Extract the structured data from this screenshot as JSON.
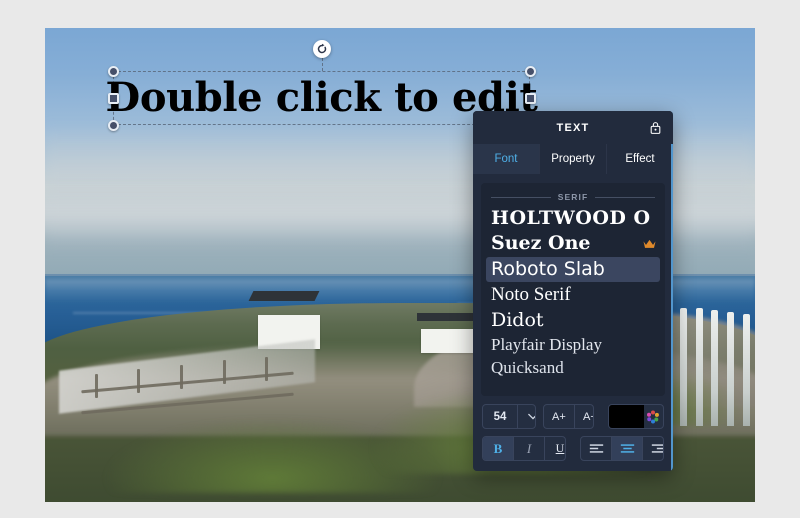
{
  "canvas": {
    "selected_text": "Double click to edit",
    "image_description": "lighthouse-coastal-photo"
  },
  "panel": {
    "title": "TEXT",
    "lock_icon": "lock-icon",
    "tabs": [
      {
        "label": "Font",
        "active": true
      },
      {
        "label": "Property",
        "active": false
      },
      {
        "label": "Effect",
        "active": false
      }
    ],
    "font_group_label": "SERIF",
    "fonts": [
      {
        "name": "HOLTWOOD O",
        "selected": false,
        "premium": false
      },
      {
        "name": "Suez One",
        "selected": false,
        "premium": true
      },
      {
        "name": "Roboto Slab",
        "selected": true,
        "premium": false
      },
      {
        "name": "Noto Serif",
        "selected": false,
        "premium": false
      },
      {
        "name": "Didot",
        "selected": false,
        "premium": false
      },
      {
        "name": "Playfair Display",
        "selected": false,
        "premium": false
      },
      {
        "name": "Quicksand",
        "selected": false,
        "premium": false
      }
    ],
    "toolbar": {
      "font_size": "54",
      "size_dropdown_icon": "chevron-down-icon",
      "increase_size_label": "A+",
      "decrease_size_label": "A−",
      "text_color": "#000000",
      "color_wheel_icon": "color-wheel-icon",
      "bold_label": "B",
      "italic_label": "I",
      "underline_label": "U",
      "align_left_icon": "align-left-icon",
      "align_center_icon": "align-center-icon",
      "align_right_icon": "align-right-icon",
      "bold_active": true,
      "align_center_active": true
    }
  },
  "colors": {
    "panel_bg": "#222b3d",
    "accent": "#4fb0e8",
    "crown": "#e08a2b",
    "page_bg": "#e9e9e9"
  }
}
